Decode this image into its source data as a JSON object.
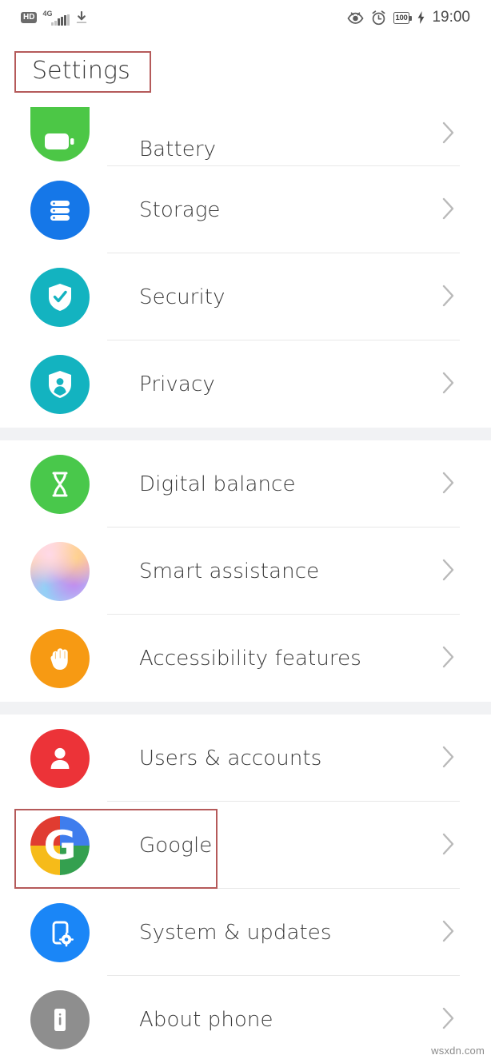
{
  "statusbar": {
    "hd_label": "HD",
    "network_label": "4G",
    "download_icon": "download-icon",
    "eye_icon": "eye-icon",
    "alarm_icon": "alarm-clock-icon",
    "battery_level": "100",
    "charging_icon": "charging-bolt-icon",
    "time": "19:00"
  },
  "header": {
    "title": "Settings",
    "annotation_color": "#b55a5a"
  },
  "sections": [
    {
      "items": [
        {
          "label": "Battery",
          "icon": "battery-icon",
          "color": "#4cc746",
          "chevron": "chevron-right-icon",
          "clipped": true,
          "divider": true
        },
        {
          "label": "Storage",
          "icon": "storage-icon",
          "color": "#1577e8",
          "chevron": "chevron-right-icon",
          "clipped": false,
          "divider": true
        },
        {
          "label": "Security",
          "icon": "shield-check-icon",
          "color": "#13b3c0",
          "chevron": "chevron-right-icon",
          "clipped": false,
          "divider": true
        },
        {
          "label": "Privacy",
          "icon": "shield-person-icon",
          "color": "#13b3c0",
          "chevron": "chevron-right-icon",
          "clipped": false,
          "divider": false
        }
      ]
    },
    {
      "items": [
        {
          "label": "Digital balance",
          "icon": "hourglass-icon",
          "color": "#49c84b",
          "chevron": "chevron-right-icon",
          "clipped": false,
          "divider": true
        },
        {
          "label": "Smart assistance",
          "icon": "sphere-icon",
          "color": "#f0a6de",
          "chevron": "chevron-right-icon",
          "clipped": false,
          "divider": true
        },
        {
          "label": "Accessibility features",
          "icon": "hand-icon",
          "color": "#f79a13",
          "chevron": "chevron-right-icon",
          "clipped": false,
          "divider": false
        }
      ]
    },
    {
      "items": [
        {
          "label": "Users & accounts",
          "icon": "person-icon",
          "color": "#ec3338",
          "chevron": "chevron-right-icon",
          "clipped": false,
          "divider": true
        },
        {
          "label": "Google",
          "icon": "google-g-icon",
          "color": "#ffffff",
          "chevron": "chevron-right-icon",
          "clipped": false,
          "divider": true,
          "annotated": true
        },
        {
          "label": "System & updates",
          "icon": "phone-gear-icon",
          "color": "#1a86f7",
          "chevron": "chevron-right-icon",
          "clipped": false,
          "divider": true
        },
        {
          "label": "About phone",
          "icon": "phone-info-icon",
          "color": "#8e8e8e",
          "chevron": "chevron-right-icon",
          "clipped": false,
          "divider": false
        }
      ]
    }
  ],
  "watermark": "wsxdn.com"
}
